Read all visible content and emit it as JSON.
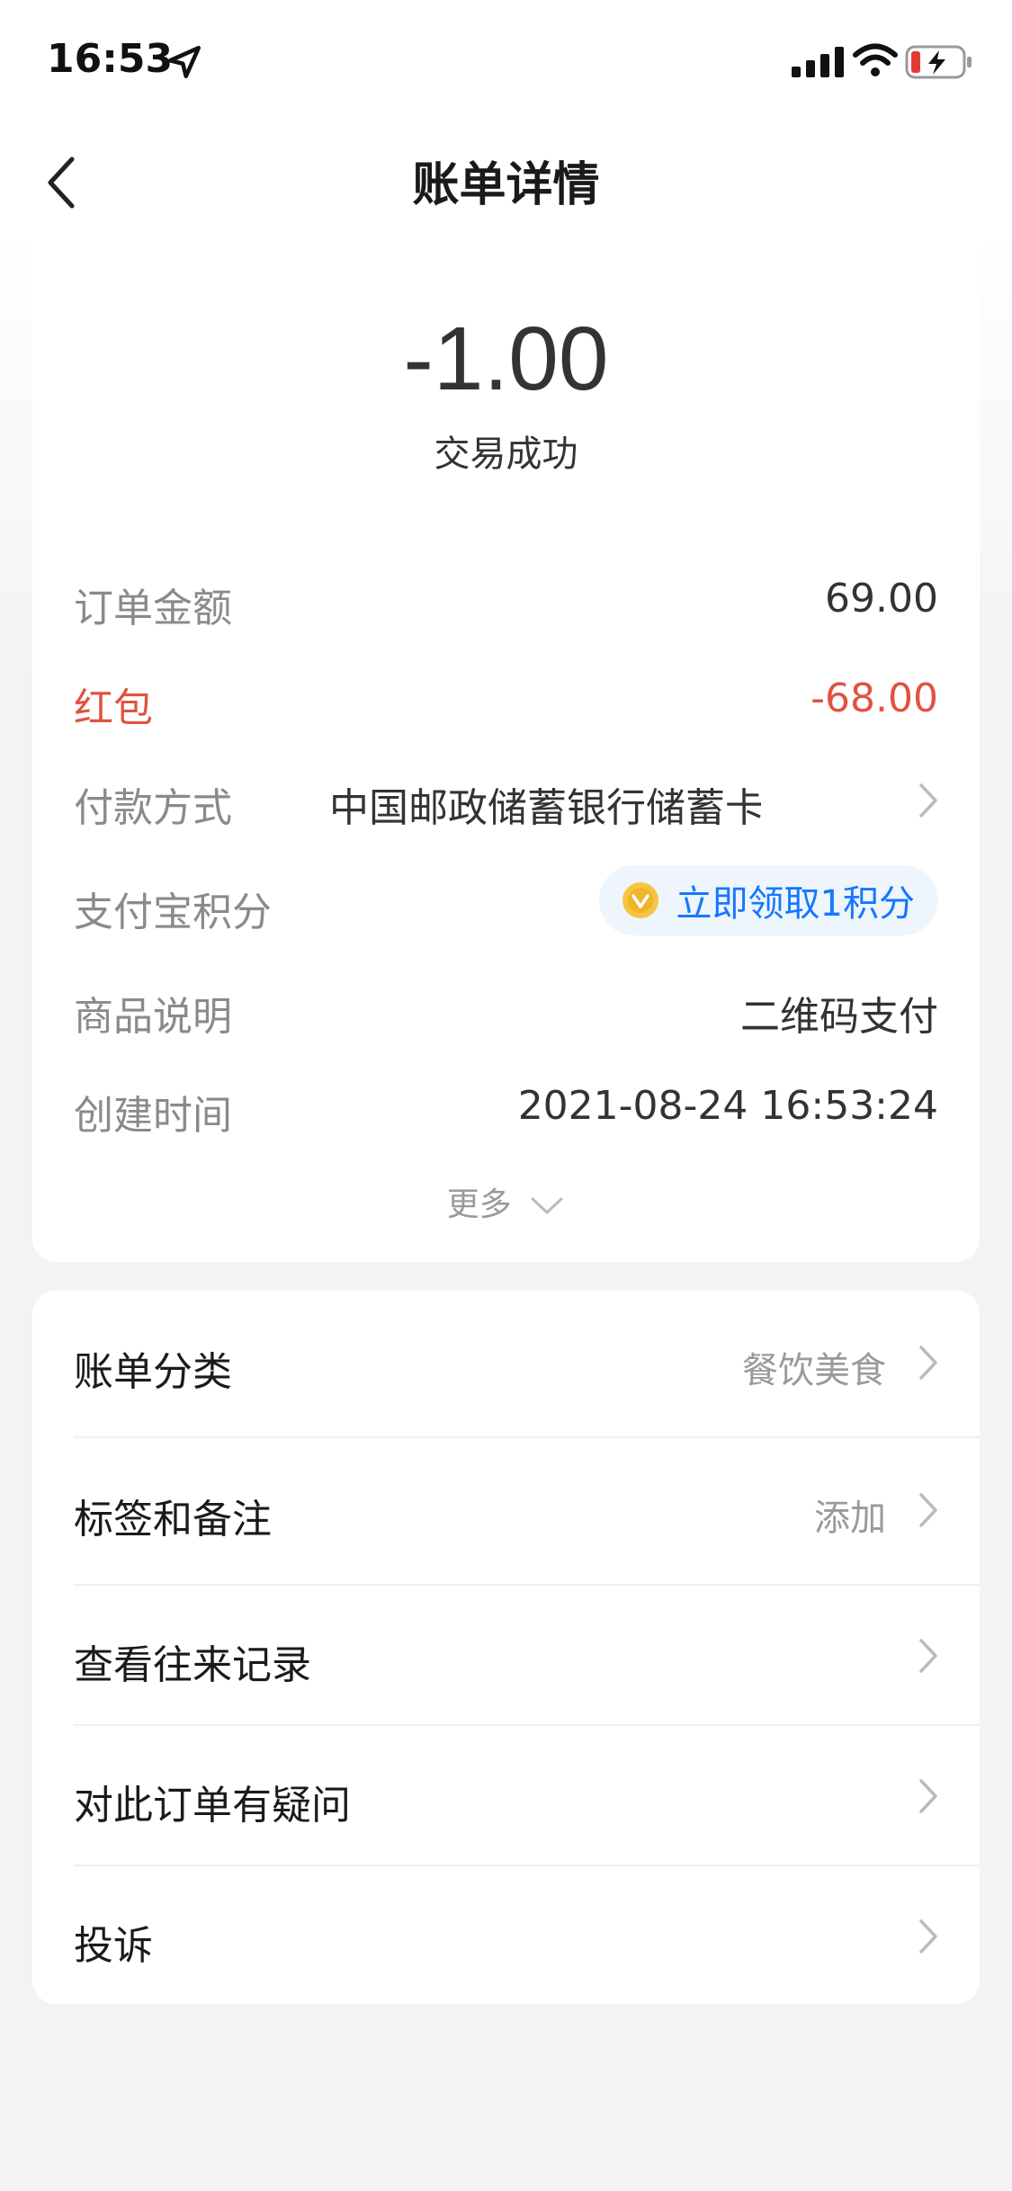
{
  "status_bar": {
    "time": "16:53"
  },
  "nav": {
    "title": "账单详情"
  },
  "summary": {
    "amount": "-1.00",
    "status": "交易成功"
  },
  "details": {
    "order_amount": {
      "label": "订单金额",
      "value": "69.00"
    },
    "red_packet": {
      "label": "红包",
      "value": "-68.00"
    },
    "payment_method": {
      "label": "付款方式",
      "value": "中国邮政储蓄银行储蓄卡"
    },
    "alipay_points": {
      "label": "支付宝积分",
      "action": "立即领取1积分"
    },
    "product_desc": {
      "label": "商品说明",
      "value": "二维码支付"
    },
    "created_time": {
      "label": "创建时间",
      "value": "2021-08-24 16:53:24"
    },
    "more": "更多"
  },
  "options": [
    {
      "label": "账单分类",
      "value": "餐饮美食"
    },
    {
      "label": "标签和备注",
      "value": "添加"
    },
    {
      "label": "查看往来记录",
      "value": ""
    },
    {
      "label": "对此订单有疑问",
      "value": ""
    },
    {
      "label": "投诉",
      "value": ""
    }
  ],
  "colors": {
    "accent": "#1677ff",
    "red": "#e0533f",
    "background": "#f3f3f3"
  }
}
